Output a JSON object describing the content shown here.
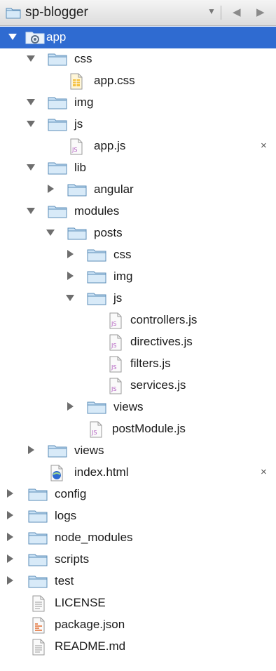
{
  "project": {
    "name": "sp-blogger",
    "dropdown_glyph": "▼",
    "back_glyph": "◀",
    "forward_glyph": "▶"
  },
  "colors": {
    "selection": "#2f6bd1",
    "folder_fill": "#c9e1f5",
    "folder_stroke": "#5b8db8"
  },
  "tree": [
    {
      "label": "app",
      "type": "root",
      "expanded": true,
      "selected": true
    },
    {
      "label": "css",
      "type": "folder",
      "expanded": true
    },
    {
      "label": "app.css",
      "type": "css"
    },
    {
      "label": "img",
      "type": "folder",
      "expanded": true
    },
    {
      "label": "js",
      "type": "folder",
      "expanded": true
    },
    {
      "label": "app.js",
      "type": "js",
      "close": "×"
    },
    {
      "label": "lib",
      "type": "folder",
      "expanded": true
    },
    {
      "label": "angular",
      "type": "folder",
      "expanded": false
    },
    {
      "label": "modules",
      "type": "folder",
      "expanded": true
    },
    {
      "label": "posts",
      "type": "folder",
      "expanded": true
    },
    {
      "label": "css",
      "type": "folder",
      "expanded": false
    },
    {
      "label": "img",
      "type": "folder",
      "expanded": false
    },
    {
      "label": "js",
      "type": "folder",
      "expanded": true
    },
    {
      "label": "controllers.js",
      "type": "js"
    },
    {
      "label": "directives.js",
      "type": "js"
    },
    {
      "label": "filters.js",
      "type": "js"
    },
    {
      "label": "services.js",
      "type": "js"
    },
    {
      "label": "views",
      "type": "folder",
      "expanded": false
    },
    {
      "label": "postModule.js",
      "type": "js"
    },
    {
      "label": "views",
      "type": "folder",
      "expanded": false
    },
    {
      "label": "index.html",
      "type": "html",
      "close": "×"
    },
    {
      "label": "config",
      "type": "folder",
      "expanded": false
    },
    {
      "label": "logs",
      "type": "folder",
      "expanded": false
    },
    {
      "label": "node_modules",
      "type": "folder",
      "expanded": false
    },
    {
      "label": "scripts",
      "type": "folder",
      "expanded": false
    },
    {
      "label": "test",
      "type": "folder",
      "expanded": false
    },
    {
      "label": "LICENSE",
      "type": "text"
    },
    {
      "label": "package.json",
      "type": "json"
    },
    {
      "label": "README.md",
      "type": "text"
    }
  ]
}
